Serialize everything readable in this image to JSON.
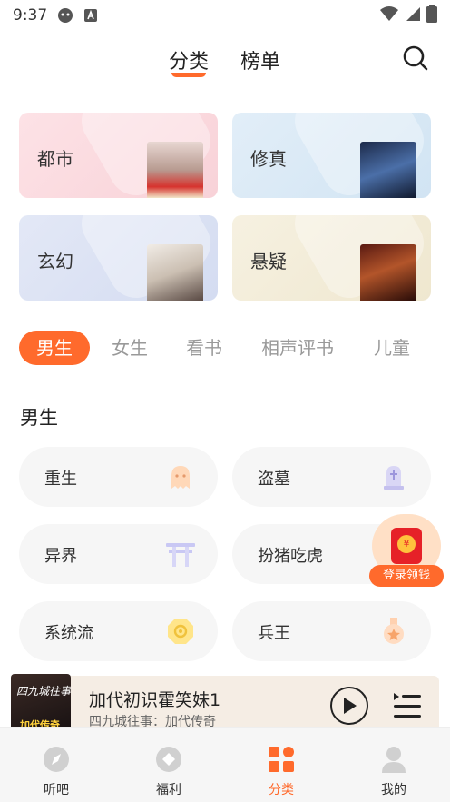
{
  "status_bar": {
    "time": "9:37"
  },
  "header": {
    "tabs": [
      {
        "label": "分类",
        "active": true
      },
      {
        "label": "榜单",
        "active": false
      }
    ]
  },
  "categories": [
    {
      "label": "都市"
    },
    {
      "label": "修真"
    },
    {
      "label": "玄幻"
    },
    {
      "label": "悬疑"
    }
  ],
  "gender_tabs": [
    {
      "label": "男生",
      "active": true
    },
    {
      "label": "女生",
      "active": false
    },
    {
      "label": "看书",
      "active": false
    },
    {
      "label": "相声评书",
      "active": false
    },
    {
      "label": "儿童",
      "active": false
    }
  ],
  "section_title": "男生",
  "subcategories": [
    {
      "label": "重生",
      "icon": "ghost-icon"
    },
    {
      "label": "盗墓",
      "icon": "tombstone-icon"
    },
    {
      "label": "异界",
      "icon": "torii-gate-icon"
    },
    {
      "label": "扮猪吃虎",
      "icon": "pig-icon"
    },
    {
      "label": "系统流",
      "icon": "system-chip-icon"
    },
    {
      "label": "兵王",
      "icon": "medal-icon"
    }
  ],
  "red_envelope": {
    "label": "登录领钱"
  },
  "player": {
    "title": "加代初识霍笑妹1",
    "subtitle": "四九城往事：加代传奇",
    "cover_text_1": "四九城往事",
    "cover_text_2": "加代传奇"
  },
  "bottom_nav": [
    {
      "label": "听吧",
      "icon": "compass-icon",
      "active": false
    },
    {
      "label": "福利",
      "icon": "diamond-icon",
      "active": false
    },
    {
      "label": "分类",
      "icon": "grid-icon",
      "active": true
    },
    {
      "label": "我的",
      "icon": "user-icon",
      "active": false
    }
  ],
  "colors": {
    "accent": "#ff6a2c",
    "envelope_red": "#e62128",
    "player_bg": "#f5ede4"
  }
}
